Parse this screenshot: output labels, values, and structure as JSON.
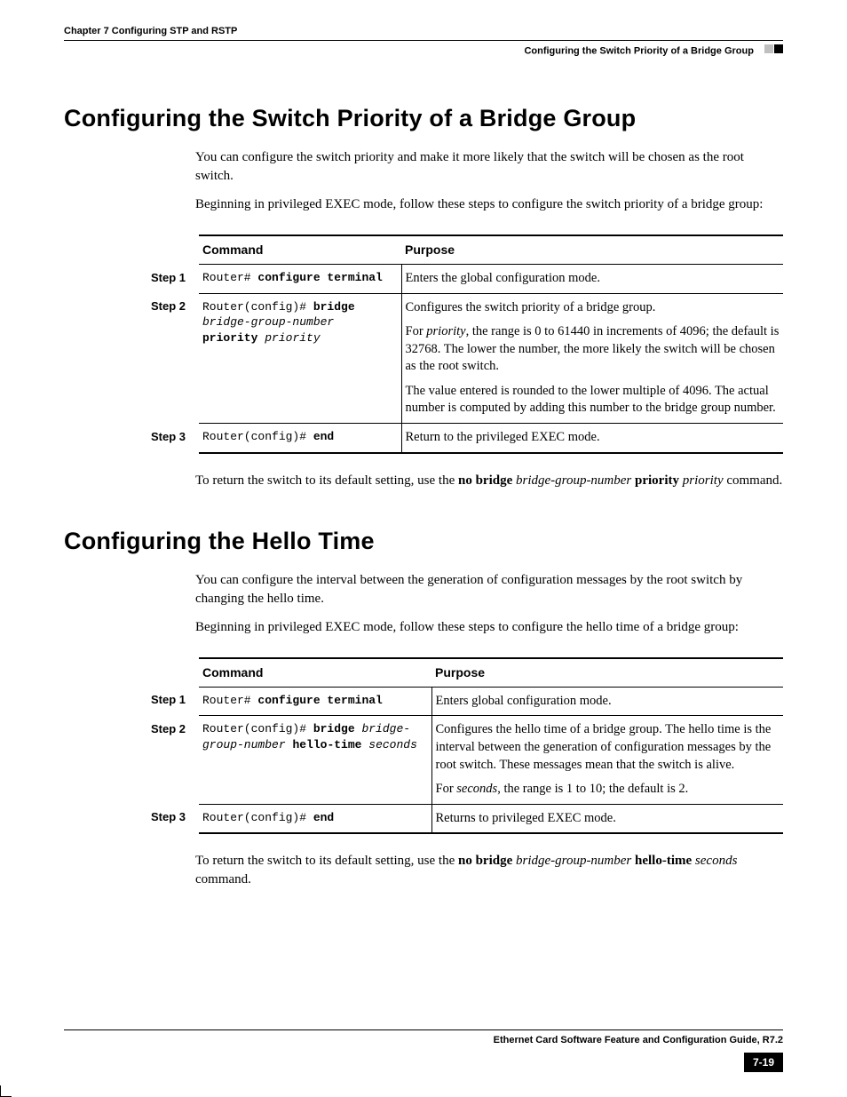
{
  "header": {
    "chapter": "Chapter 7    Configuring STP and RSTP",
    "section": "Configuring the Switch Priority of a Bridge Group"
  },
  "s1": {
    "heading": "Configuring the Switch Priority of a Bridge Group",
    "p1": "You can configure the switch priority and make it more likely that the switch will be chosen as the root switch.",
    "p2": "Beginning in privileged EXEC mode, follow these steps to configure the switch priority of a bridge group:",
    "table": {
      "col_command": "Command",
      "col_purpose": "Purpose",
      "step1_label": "Step 1",
      "step2_label": "Step 2",
      "step3_label": "Step 3",
      "r1": {
        "cmd_prefix": "Router# ",
        "cmd_bold": "configure terminal",
        "purpose": "Enters the global configuration mode."
      },
      "r2": {
        "cmd_prefix": "Router(config)# ",
        "cmd_bold1": "bridge",
        "cmd_ital": "bridge-group-number",
        "cmd_bold2": "priority",
        "cmd_ital2": "priority",
        "purpose_a": "Configures the switch priority of a bridge group.",
        "purpose_b_pre": "For ",
        "purpose_b_var": "priority",
        "purpose_b_post": ", the range is 0 to 61440 in increments of 4096; the default is 32768. The lower the number, the more likely the switch will be chosen as the root switch.",
        "purpose_c": "The value entered is rounded to the lower multiple of 4096. The actual number is computed by adding this number to the bridge group number."
      },
      "r3": {
        "cmd_prefix": "Router(config)# ",
        "cmd_bold": "end",
        "purpose": "Return to the privileged EXEC mode."
      }
    },
    "tail_pre": "To return the switch to its default setting, use the ",
    "tail_kw1": "no bridge",
    "tail_var1": "bridge-group-number",
    "tail_kw2": "priority",
    "tail_var2": "priority",
    "tail_post": " command."
  },
  "s2": {
    "heading": "Configuring the Hello Time",
    "p1": "You can configure the interval between the generation of configuration messages by the root switch by changing the hello time.",
    "p2": "Beginning in privileged EXEC mode, follow these steps to configure the hello time of a bridge group:",
    "table": {
      "col_command": "Command",
      "col_purpose": "Purpose",
      "step1_label": "Step 1",
      "step2_label": "Step 2",
      "step3_label": "Step 3",
      "r1": {
        "cmd_prefix": "Router# ",
        "cmd_bold": "configure terminal",
        "purpose": "Enters global configuration mode."
      },
      "r2": {
        "cmd_prefix": "Router(config)# ",
        "cmd_bold1": "bridge",
        "cmd_ital": "bridge-group-number",
        "cmd_bold2": "hello-time",
        "cmd_ital2": "seconds",
        "purpose_a": "Configures the hello time of a bridge group. The hello time is the interval between the generation of configuration messages by the root switch. These messages mean that the switch is alive.",
        "purpose_b_pre": "For ",
        "purpose_b_var": "seconds",
        "purpose_b_post": ", the range is 1 to 10; the default is 2."
      },
      "r3": {
        "cmd_prefix": "Router(config)# ",
        "cmd_bold": "end",
        "purpose": "Returns to privileged EXEC mode."
      }
    },
    "tail_pre": "To return the switch to its default setting, use the ",
    "tail_kw1": "no bridge",
    "tail_var1": "bridge-group-number",
    "tail_kw2": "hello-time",
    "tail_var2": "seconds",
    "tail_post": " command."
  },
  "footer": {
    "title": "Ethernet Card Software Feature and Configuration Guide, R7.2",
    "pagenum": "7-19"
  }
}
